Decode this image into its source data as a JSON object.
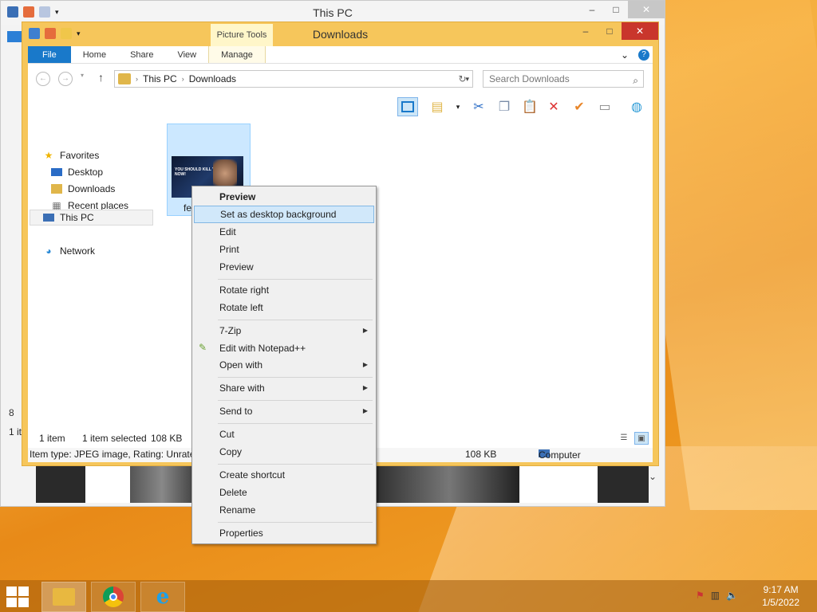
{
  "back_window": {
    "title": "This PC",
    "status_count": "1 it",
    "status_fragment": "8"
  },
  "window": {
    "title": "Downloads",
    "context_tab": "Picture Tools",
    "controls": {
      "minimize": "–",
      "maximize": "□",
      "close": "✕"
    }
  },
  "ribbon": {
    "tabs": [
      "File",
      "Home",
      "Share",
      "View",
      "Manage"
    ],
    "help": "?",
    "collapse": "⌄"
  },
  "address": {
    "crumbs": [
      "This PC",
      "Downloads"
    ],
    "separator": "›",
    "search_placeholder": "Search Downloads"
  },
  "navigation": {
    "favorites": "Favorites",
    "items": [
      "Desktop",
      "Downloads",
      "Recent places"
    ],
    "this_pc": "This PC",
    "network": "Network"
  },
  "file": {
    "name_visible": "fe",
    "thumb_text": "YOU SHOULD KILL YOURSELF NOW!"
  },
  "status": {
    "item_count": "1 item",
    "selected": "1 item selected",
    "size": "108 KB"
  },
  "details": {
    "item_type": "Item type: JPEG image, Rating: Unrated",
    "size": "108 KB",
    "location": "Computer"
  },
  "context_menu": {
    "items": [
      "Preview",
      "Set as desktop background",
      "Edit",
      "Print",
      "Preview",
      "Rotate right",
      "Rotate left",
      "7-Zip",
      "Edit with Notepad++",
      "Open with",
      "Share with",
      "Send to",
      "Cut",
      "Copy",
      "Create shortcut",
      "Delete",
      "Rename",
      "Properties"
    ],
    "default_item": "Preview",
    "highlighted_item": "Set as desktop background"
  },
  "taskbar": {
    "apps": [
      "file-explorer",
      "google-chrome",
      "internet-explorer"
    ],
    "time": "9:17 AM",
    "date": "1/5/2022"
  },
  "colors": {
    "accent": "#1979ca",
    "window_frame": "#f6c65b",
    "close_button": "#c9362c",
    "selection": "#cce8ff"
  }
}
